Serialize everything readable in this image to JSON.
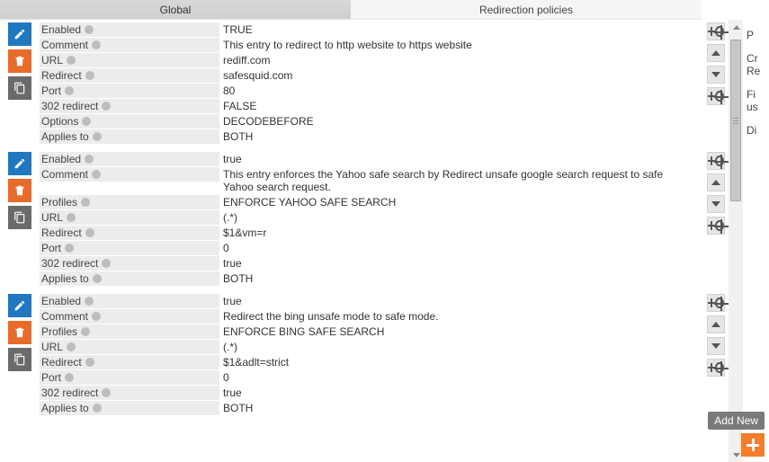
{
  "tabs": {
    "global": "Global",
    "redir": "Redirection policies"
  },
  "labels": {
    "enabled": "Enabled",
    "comment": "Comment",
    "url": "URL",
    "redirect": "Redirect",
    "port": "Port",
    "r302": "302 redirect",
    "options": "Options",
    "applies": "Applies to",
    "profiles": "Profiles"
  },
  "entries": [
    {
      "enabled": "TRUE",
      "comment": "This entry to redirect to http website to https website",
      "url": "rediff.com",
      "redirect": "safesquid.com",
      "port": "80",
      "r302": "FALSE",
      "options": "DECODEBEFORE",
      "applies": "BOTH"
    },
    {
      "enabled": "true",
      "comment": "This entry enforces the Yahoo safe search by Redirect unsafe google search request to safe Yahoo search request.",
      "profiles": "ENFORCE YAHOO SAFE SEARCH",
      "url": "(.*)",
      "redirect": "$1&vm=r",
      "port": "0",
      "r302": "true",
      "applies": "BOTH"
    },
    {
      "enabled": "true",
      "comment": "Redirect the bing unsafe mode to safe mode.",
      "profiles": "ENFORCE BING SAFE SEARCH",
      "url": "(.*)",
      "redirect": "$1&adlt=strict",
      "port": "0",
      "r302": "true",
      "applies": "BOTH"
    }
  ],
  "side": {
    "p": "P",
    "cr": "Cr",
    "re": "Re",
    "fi": "Fi",
    "us": "us",
    "di": "Di"
  },
  "addnew": "Add New"
}
